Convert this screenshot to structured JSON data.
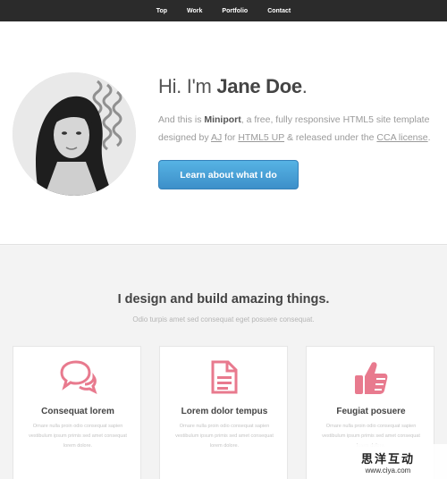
{
  "nav": {
    "items": [
      "Top",
      "Work",
      "Portfolio",
      "Contact"
    ]
  },
  "hero": {
    "greeting": "Hi. I'm ",
    "name": "Jane Doe",
    "period": ".",
    "intro_1": "And this is ",
    "intro_brand": "Miniport",
    "intro_2": ", a free, fully responsive HTML5 site template designed by ",
    "author_link": "AJ",
    "intro_3": " for ",
    "site_link": "HTML5 UP",
    "intro_4": " & released under the ",
    "license_link": "CCA license",
    "intro_5": ".",
    "cta_label": "Learn about what I do"
  },
  "features": {
    "title": "I design and build amazing things.",
    "subtitle": "Odio turpis amet sed consequat eget posuere consequat.",
    "cards": [
      {
        "icon": "speech-bubbles-icon",
        "title": "Consequat lorem",
        "text": "Ornare nulla proin odio consequat sapien vestibulum ipsum primis sed amet consequat lorem dolore."
      },
      {
        "icon": "document-icon",
        "title": "Lorem dolor tempus",
        "text": "Ornare nulla proin odio consequat sapien vestibulum ipsum primis sed amet consequat lorem dolore."
      },
      {
        "icon": "thumbs-up-icon",
        "title": "Feugiat posuere",
        "text": "Ornare nulla proin odio consequat sapien vestibulum ipsum primis sed amet consequat lorem dolore."
      }
    ]
  },
  "watermark": {
    "text": "思洋互动",
    "url": "www.ciya.com"
  },
  "colors": {
    "accent": "#e87a8e",
    "button": "#4aa3d9",
    "nav_bg": "#2b2b2b"
  }
}
